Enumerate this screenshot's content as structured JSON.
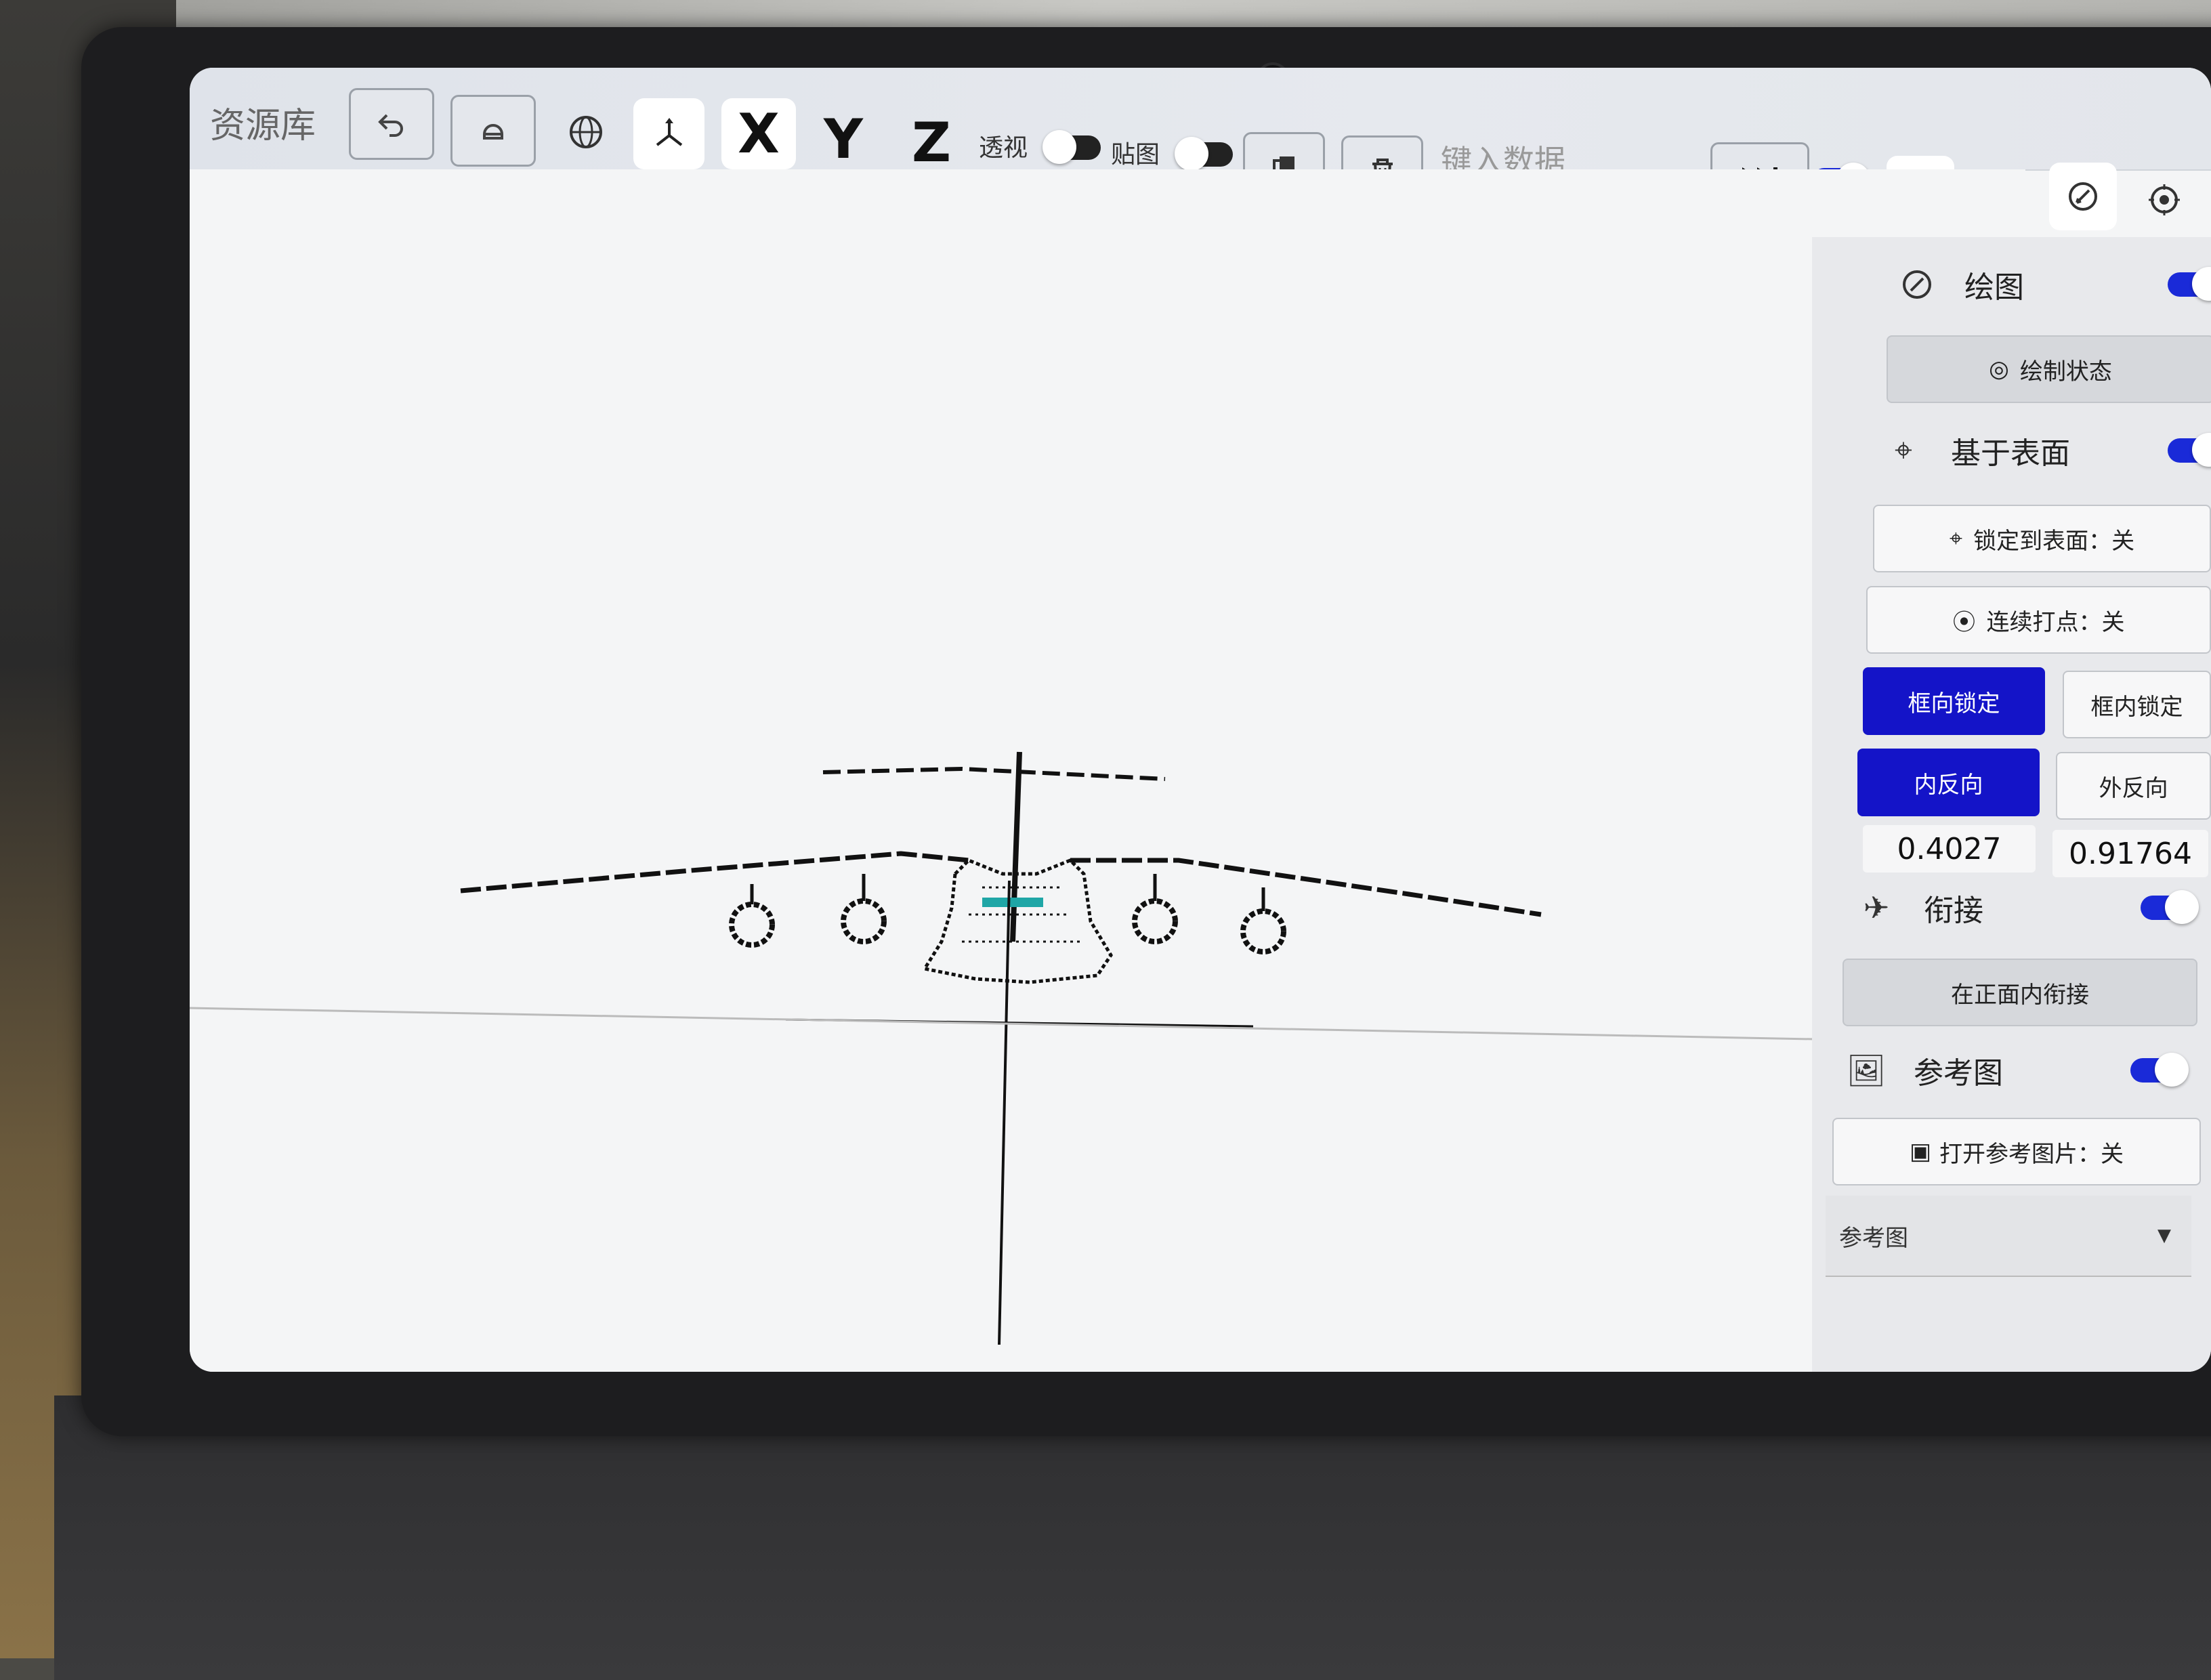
{
  "toolbar": {
    "library_label": "资源库",
    "axis_x": "X",
    "axis_y": "Y",
    "axis_z": "Z",
    "perspective_label": "透视",
    "texture_label": "贴图",
    "data_input_placeholder": "键入数据",
    "perspective_on": false,
    "texture_on": false,
    "mode_toggle_on": true
  },
  "panel": {
    "draw": {
      "title": "绘图",
      "state_button": "绘制状态",
      "enabled": true
    },
    "surface": {
      "title": "基于表面",
      "enabled": true,
      "lock_to_surface": "锁定到表面：关",
      "continuous_points": "连续打点：关",
      "frame_lock": "框向锁定",
      "inner_lock": "框内锁定",
      "inner_reverse": "内反向",
      "outer_reverse": "外反向",
      "value_left": "0.4027",
      "value_right": "0.91764"
    },
    "join": {
      "title": "衔接",
      "enabled": true,
      "front_join": "在正面内衔接"
    },
    "reference": {
      "title": "参考图",
      "enabled": true,
      "open_button": "打开参考图片：关",
      "select_value": "参考图"
    }
  },
  "colors": {
    "accent_blue": "#1414c8",
    "toolbar_bg": "#e2e5ea",
    "canvas_bg": "#f4f5f6",
    "model_line": "#111111",
    "highlight_cyan": "#1fa6a6"
  },
  "icons": {
    "undo": "undo-icon",
    "eraser": "eraser-icon",
    "globe": "globe-icon",
    "axes": "axes-icon",
    "copy": "copy-icon",
    "delete": "trash-icon",
    "fast_forward": "fast-forward-icon",
    "image": "image-icon",
    "share": "share-icon",
    "draw": "pencil-circle-icon",
    "target": "target-icon"
  }
}
